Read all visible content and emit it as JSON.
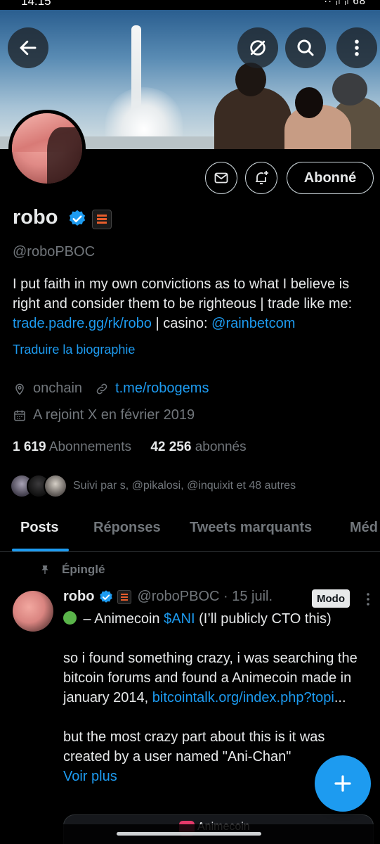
{
  "status": {
    "time": "14:15",
    "right": "·· ᵢₗ ᵢₗ 68"
  },
  "profile": {
    "name": "robo",
    "handle": "@roboPBOC",
    "bio_text": "I put faith in my own convictions as to what I believe is right and consider them to be righteous | trade like me: ",
    "bio_link1": "trade.padre.gg/rk/robo",
    "bio_sep": " | casino: ",
    "bio_link2": "@rainbetcom",
    "translate": "Traduire la biographie",
    "location": "onchain",
    "website": "t.me/robogems",
    "joined": "A rejoint X en février 2019",
    "following_count": "1 619",
    "following_label": "Abonnements",
    "followers_count": "42 256",
    "followers_label": "abonnés",
    "followed_by": "Suivi par s, @pikalosi, @inquixit et 48 autres",
    "follow_button": "Abonné"
  },
  "tabs": [
    "Posts",
    "Réponses",
    "Tweets marquants",
    "Méd"
  ],
  "tweet": {
    "pinned_label": "Épinglé",
    "name": "robo",
    "handle_date": "@roboPBOC · 15 juil.",
    "badge": "Modo",
    "line1_a": " – Animecoin ",
    "line1_cashtag": "$ANI",
    "line1_b": " (I’ll publicly CTO this)",
    "para2": "so i found something crazy, i was searching the bitcoin forums and found a Animecoin made in january 2014, ",
    "para2_link": "bitcointalk.org/index.php?topi",
    "para2_ellipsis": "...",
    "para3": "but the most crazy part about this is it was created by a user named \"Ani-Chan\"",
    "see_more": "Voir plus",
    "card_title": "Animecoin"
  },
  "colors": {
    "accent": "#1d9bf0",
    "bg": "#000000",
    "muted": "#71767b",
    "text": "#e7e9ea"
  },
  "icons": [
    "back-arrow-icon",
    "hide-icon",
    "search-icon",
    "more-vertical-icon",
    "message-icon",
    "bell-plus-icon",
    "verified-icon",
    "location-icon",
    "link-icon",
    "calendar-icon",
    "pin-icon",
    "plus-icon"
  ]
}
